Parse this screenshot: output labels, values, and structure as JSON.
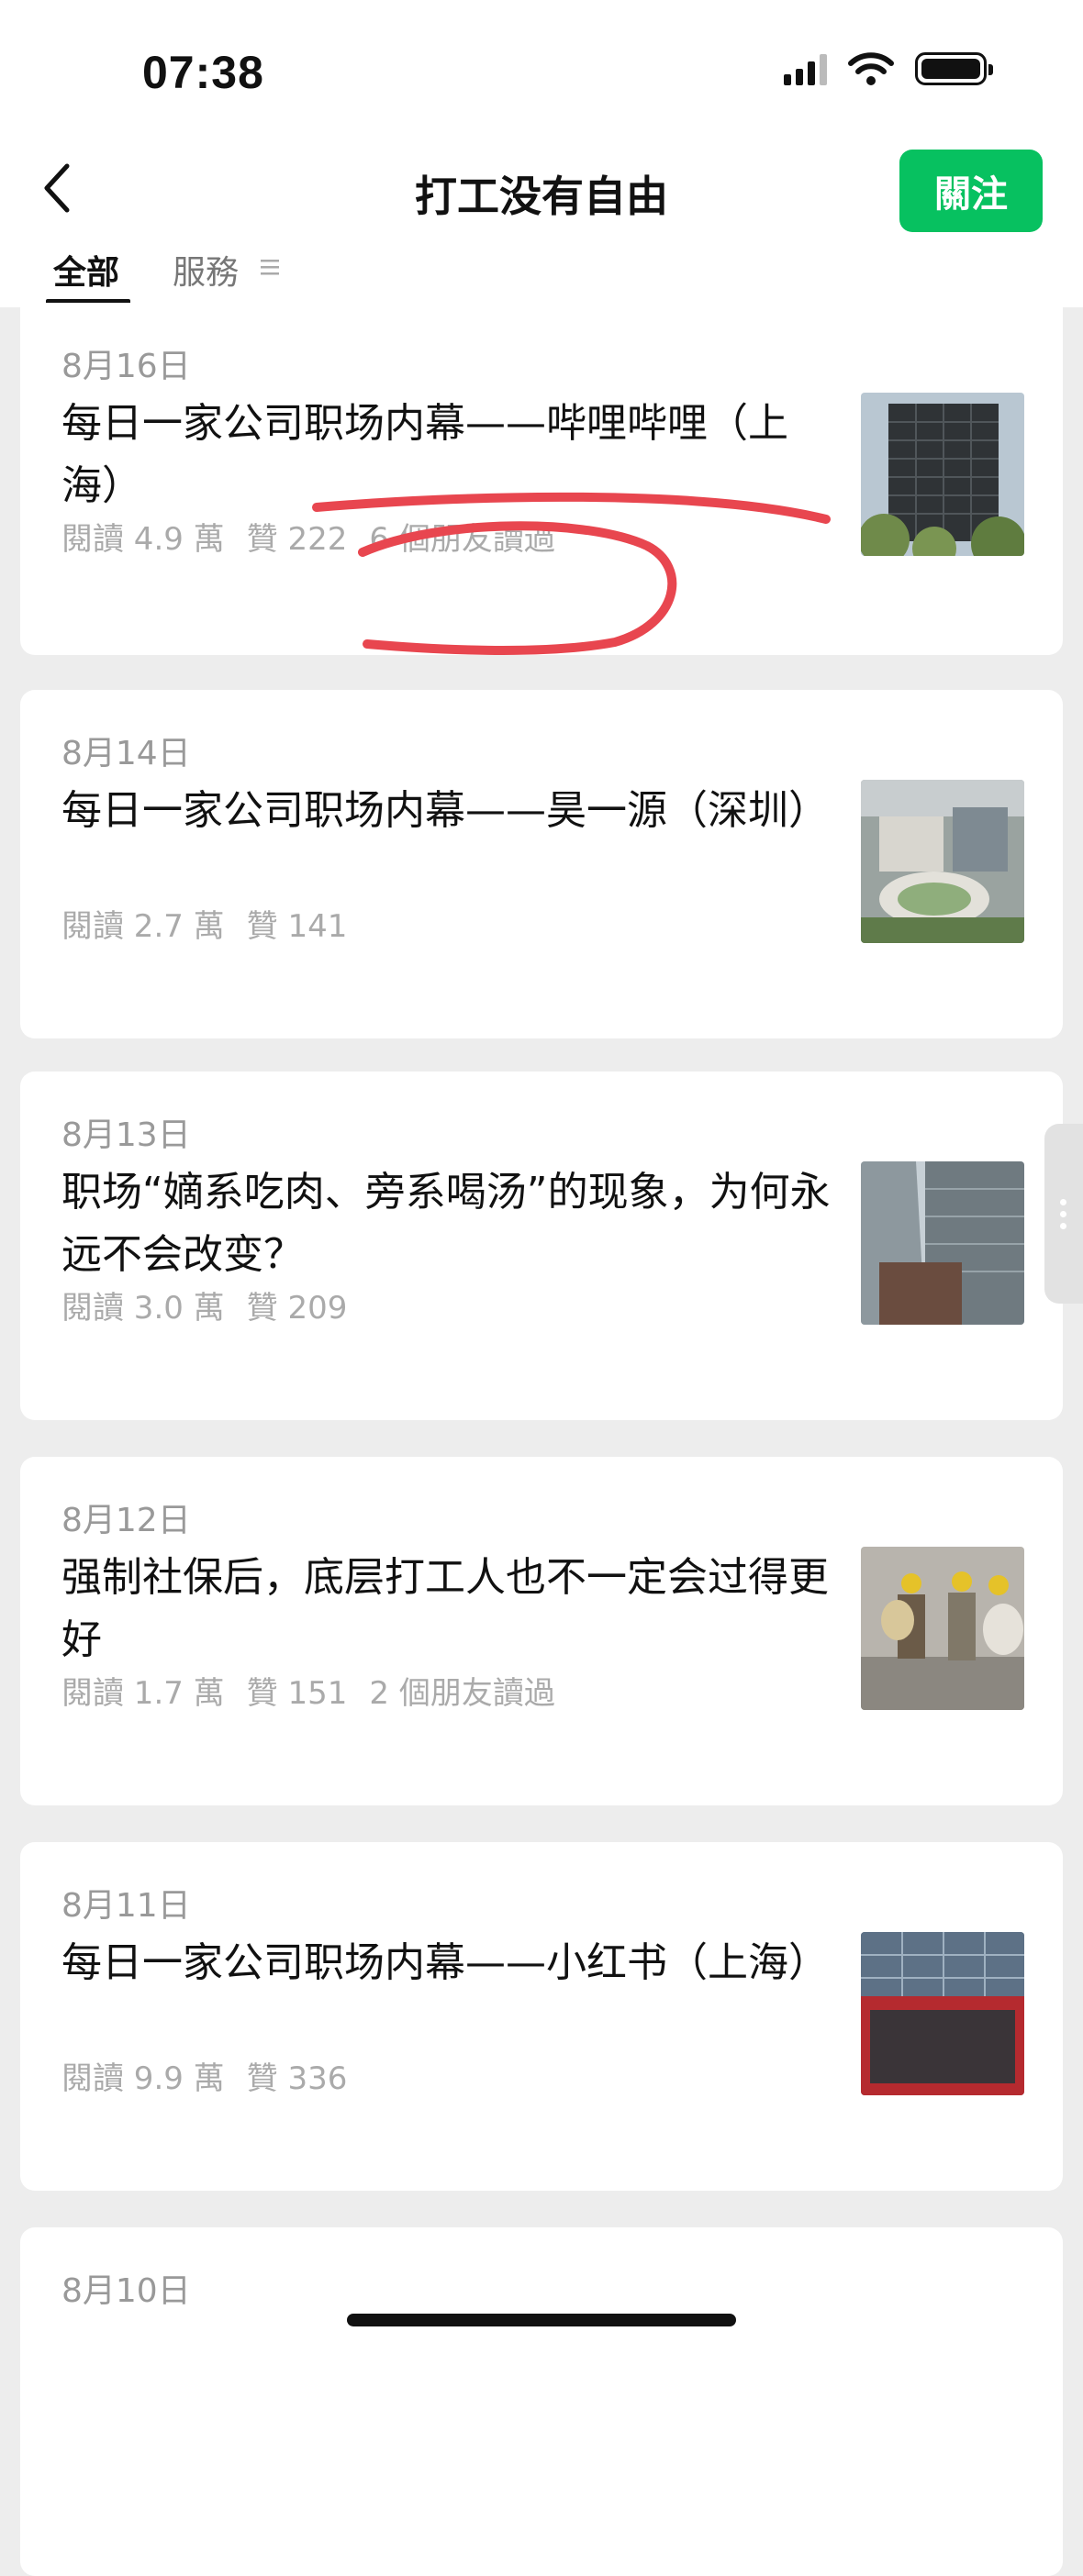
{
  "status_bar": {
    "time": "07:38"
  },
  "header": {
    "title": "打工没有自由",
    "follow_label": "關注"
  },
  "tabs": [
    {
      "label": "全部",
      "active": true
    },
    {
      "label": "服務",
      "active": false
    }
  ],
  "articles": [
    {
      "date": "8月16日",
      "title": "每日一家公司职场内幕——哔哩哔哩（上海）",
      "reads": "閱讀 4.9 萬",
      "likes": "贊 222",
      "friends": "6 個朋友讀過"
    },
    {
      "date": "8月14日",
      "title": "每日一家公司职场内幕——昊一源（深圳）",
      "reads": "閱讀 2.7 萬",
      "likes": "贊 141",
      "friends": ""
    },
    {
      "date": "8月13日",
      "title": "职场“嫡系吃肉、旁系喝汤”的现象，为何永远不会改变？",
      "reads": "閱讀 3.0 萬",
      "likes": "贊 209",
      "friends": ""
    },
    {
      "date": "8月12日",
      "title": "强制社保后，底层打工人也不一定会过得更好",
      "reads": "閱讀 1.7 萬",
      "likes": "贊 151",
      "friends": "2 個朋友讀過"
    },
    {
      "date": "8月11日",
      "title": "每日一家公司职场内幕——小红书（上海）",
      "reads": "閱讀 9.9 萬",
      "likes": "贊 336",
      "friends": ""
    },
    {
      "date": "8月10日",
      "title": "",
      "reads": "",
      "likes": "",
      "friends": ""
    }
  ],
  "colors": {
    "accent": "#07c160",
    "annotation": "#e8464f",
    "background": "#ededed"
  }
}
